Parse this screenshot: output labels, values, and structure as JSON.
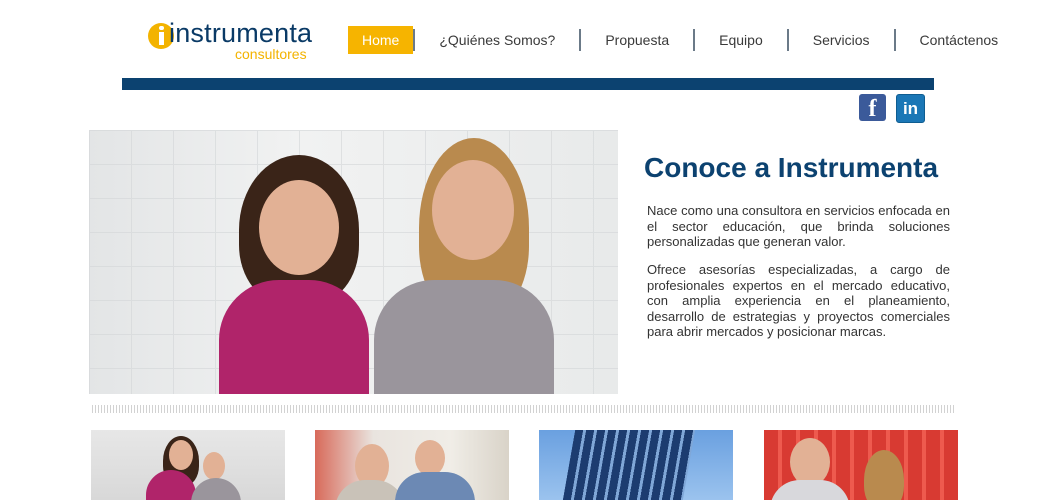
{
  "brand": {
    "name": "instrumenta",
    "tagline": "consultores"
  },
  "nav": {
    "items": [
      {
        "label": "Home",
        "active": true
      },
      {
        "label": "¿Quiénes Somos?",
        "active": false
      },
      {
        "label": "Propuesta",
        "active": false
      },
      {
        "label": "Equipo",
        "active": false
      },
      {
        "label": "Servicios",
        "active": false
      },
      {
        "label": "Contáctenos",
        "active": false
      }
    ]
  },
  "social": {
    "facebook": "f",
    "linkedin": "in"
  },
  "hero": {
    "title": "Conoce a Instrumenta",
    "paragraph1": "Nace como una consultora en servicios enfocada en el sector educación, que brinda soluciones personalizadas que generan valor.",
    "paragraph2": "Ofrece asesorías especializadas, a cargo de profesionales expertos en el mercado educativo, con amplia experiencia en el planeamiento, desarrollo de estrategias y proyectos comerciales para abrir mercados y posicionar marcas."
  },
  "colors": {
    "accent": "#f6b400",
    "brand_blue": "#0c4270"
  }
}
